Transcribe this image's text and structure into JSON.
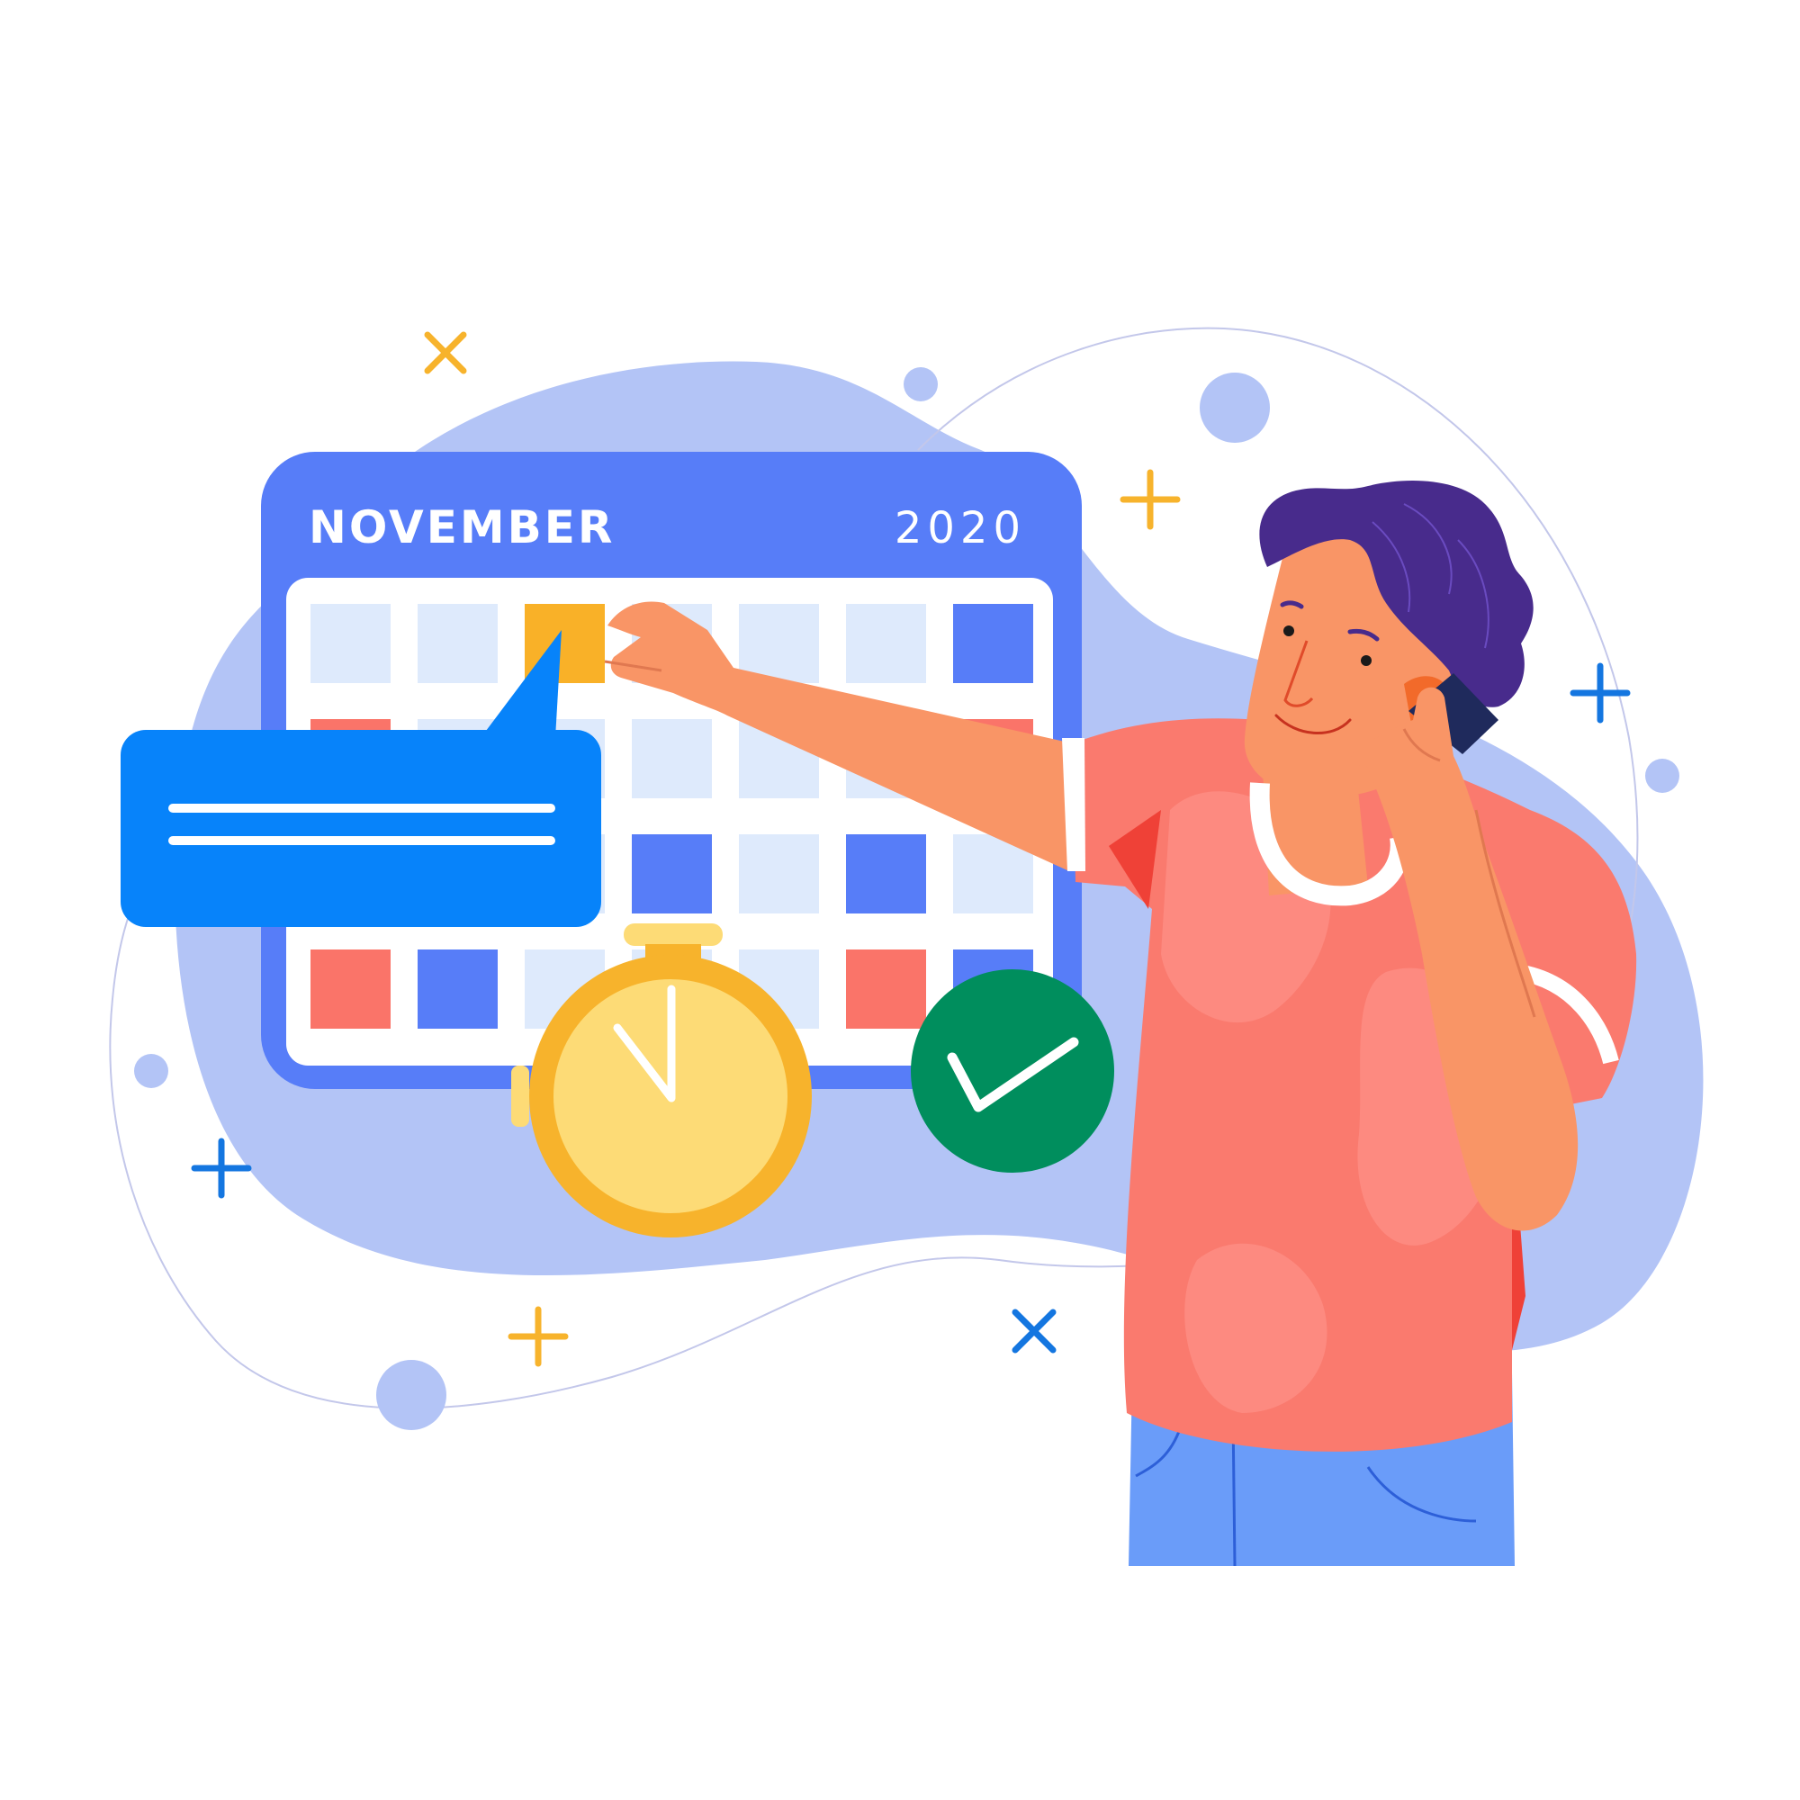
{
  "calendar": {
    "month": "NOVEMBER",
    "year": "2020",
    "rows": [
      [
        "empty",
        "empty",
        "yellow",
        "empty",
        "empty",
        "empty",
        "blue"
      ],
      [
        "red",
        "empty",
        "empty",
        "empty",
        "empty",
        "empty",
        "red"
      ],
      [
        "empty",
        "empty",
        "empty",
        "blue",
        "empty",
        "blue",
        "empty"
      ],
      [
        "red",
        "blue",
        "empty",
        "empty",
        "empty",
        "red",
        "blue"
      ]
    ]
  },
  "colors": {
    "calendar_frame": "#577df8",
    "calendar_face": "#ffffff",
    "cell_empty": "#deeafc",
    "cell_blue": "#577df8",
    "cell_red": "#fa7469",
    "cell_yellow": "#f9b128",
    "blob": "#b3c4f6",
    "speech_bubble": "#0783fa",
    "stopwatch_ring": "#f7b32c",
    "stopwatch_face": "#fddb76",
    "check_badge": "#008e5d",
    "shirt": "#fa7a6e",
    "skin": "#f99566",
    "hair": "#482b8c",
    "jeans": "#6a9cf9"
  },
  "icons": {
    "speech_bubble": "speech-bubble-icon",
    "stopwatch": "stopwatch-icon",
    "checkmark": "checkmark-icon"
  }
}
